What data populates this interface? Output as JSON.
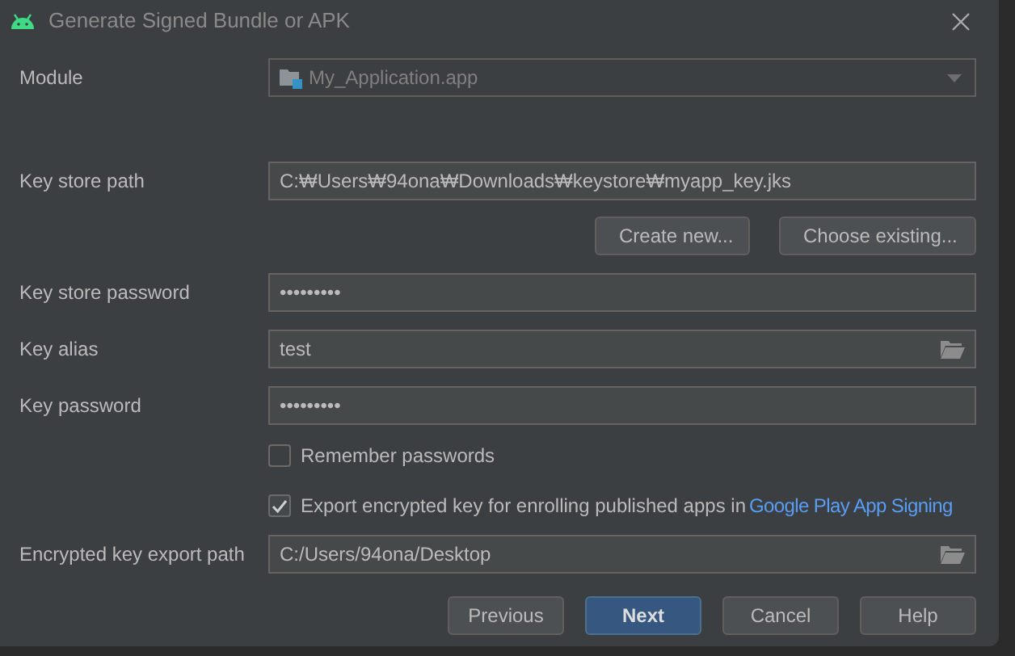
{
  "window": {
    "title": "Generate Signed Bundle or APK"
  },
  "module": {
    "label": "Module",
    "value": "My_Application.app",
    "disabled": true
  },
  "key_store_path": {
    "label": "Key store path",
    "value": "C:₩Users₩94ona₩Downloads₩keystore₩myapp_key.jks"
  },
  "key_store_buttons": [
    "Create new...",
    "Choose existing..."
  ],
  "key_store_password": {
    "label": "Key store password",
    "value": "•••••••••"
  },
  "key_alias": {
    "label": "Key alias",
    "value": "test"
  },
  "key_password": {
    "label": "Key password",
    "value": "•••••••••"
  },
  "checkboxes": [
    {
      "label": "Remember passwords",
      "checked": false
    },
    {
      "label": "Export encrypted key for enrolling published apps in",
      "link": "Google Play App Signing",
      "checked": true
    }
  ],
  "export_path": {
    "label": "Encrypted key export path",
    "value": "C:/Users/94ona/Desktop"
  },
  "buttons": [
    {
      "label": "Previous",
      "primary": false
    },
    {
      "label": "Next",
      "primary": true
    },
    {
      "label": "Cancel",
      "primary": false
    },
    {
      "label": "Help",
      "primary": false
    }
  ]
}
